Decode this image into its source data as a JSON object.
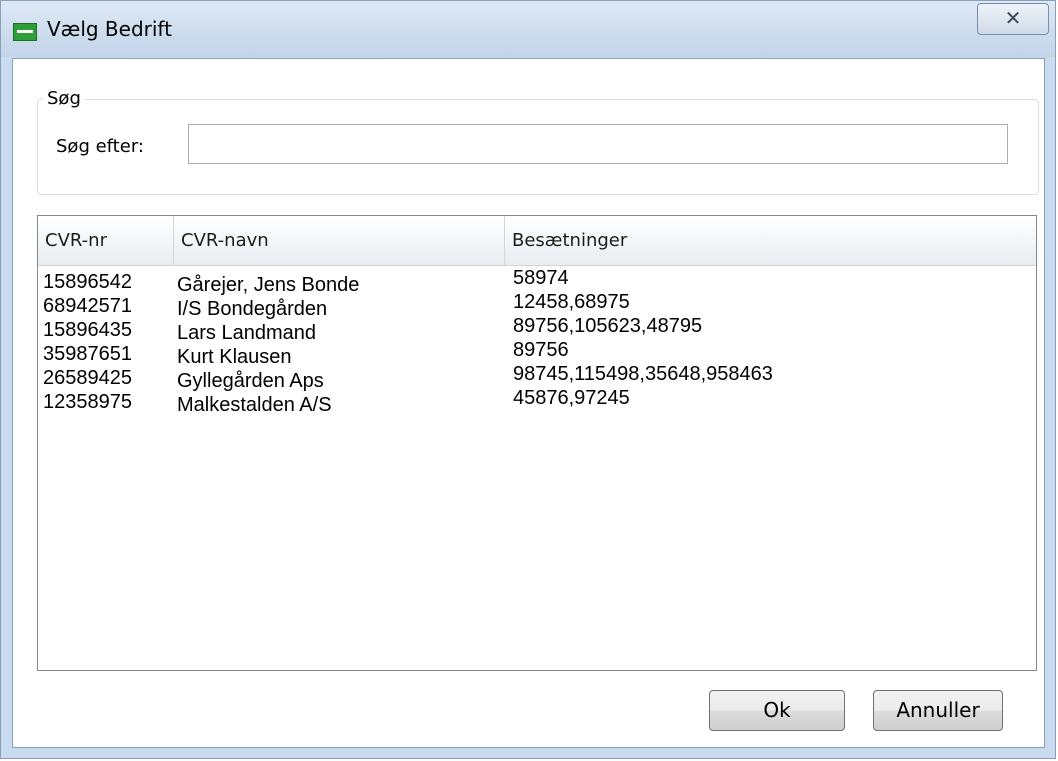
{
  "window": {
    "title": "Vælg Bedrift",
    "close_glyph": "✕"
  },
  "search": {
    "group_title": "Søg",
    "label": "Søg efter:",
    "value": "",
    "placeholder": ""
  },
  "table": {
    "columns": [
      "CVR-nr",
      "CVR-navn",
      "Besætninger"
    ],
    "rows": [
      [
        "15896542",
        "Gårejer, Jens Bonde",
        "58974"
      ],
      [
        "68942571",
        "I/S Bondegården",
        "12458,68975"
      ],
      [
        "15896435",
        "Lars Landmand",
        "89756,105623,48795"
      ],
      [
        "35987651",
        "Kurt Klausen",
        "89756"
      ],
      [
        "26589425",
        "Gyllegården Aps",
        "98745,115498,35648,958463"
      ],
      [
        "12358975",
        "Malkestalden A/S",
        "45876,97245"
      ]
    ]
  },
  "buttons": {
    "ok": "Ok",
    "cancel": "Annuller"
  },
  "icons": {
    "app": "app-icon",
    "close": "close-icon"
  }
}
